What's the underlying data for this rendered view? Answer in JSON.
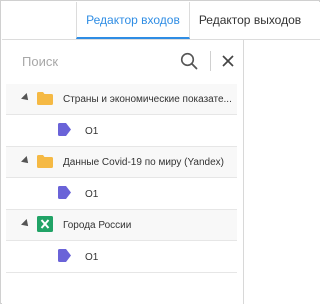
{
  "tabs": {
    "inputs_label": "Редактор входов",
    "outputs_label": "Редактор выходов"
  },
  "search": {
    "placeholder": "Поиск",
    "value": ""
  },
  "tree": {
    "nodes": [
      {
        "type": "folder",
        "label": "Страны и экономические показате...",
        "children": [
          {
            "label": "O1"
          }
        ]
      },
      {
        "type": "folder",
        "label": "Данные Covid-19 по миру (Yandex)",
        "children": [
          {
            "label": "O1"
          }
        ]
      },
      {
        "type": "excel",
        "label": "Города России",
        "children": [
          {
            "label": "O1"
          }
        ]
      }
    ]
  },
  "colors": {
    "accent": "#2f8de4",
    "folder": "#f5b944",
    "excel": "#21a366",
    "tag": "#6a63d8"
  }
}
